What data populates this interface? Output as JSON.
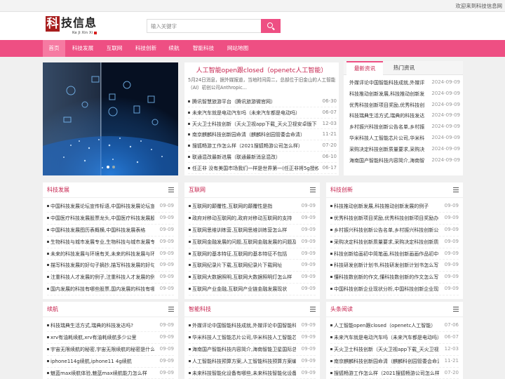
{
  "topbar": {
    "welcome": "欢迎来到科技信息网"
  },
  "logo": {
    "char": "科",
    "title": "技信息",
    "subtitle": "Ke Ji Xin Xi"
  },
  "search": {
    "placeholder": "输入关键字",
    "icon": "search-icon"
  },
  "nav": [
    "首页",
    "科技发展",
    "互联网",
    "科技创新",
    "续航",
    "智能科技",
    "网站地图"
  ],
  "headline": {
    "title": "人工智能open跟closed（openetc人工智能）",
    "summary": "5月24日消息，据外媒报道，当地时间周二，总部位于旧金山的人工智能（AI）初创公司Anthropic..."
  },
  "headline_list": [
    {
      "text": "腾讯智慧旅游平台（腾讯旅游微官网）",
      "date": "06-30"
    },
    {
      "text": "未来汽车就是电动汽车吗（未来汽车都是电动吗）",
      "date": "06-07"
    },
    {
      "text": "天火卫士科技创新（天火卫视app下载_天火卫视安卓版下",
      "date": "12-03"
    },
    {
      "text": "南京麒麟科技创新园命清（麒麟科创园管委会命清）",
      "date": "11-21"
    },
    {
      "text": "搜狐畅游工作怎么样（2021搜狐畅游公司怎么样）",
      "date": "07-20"
    },
    {
      "text": "联通混改最新进展（联通最新消息混改）",
      "date": "06-10"
    },
    {
      "text": "任正非 没有美国市场我们一样是世界第一(任正非将5g授权",
      "date": "06-17"
    }
  ],
  "news_tabs": [
    "最新资讯",
    "热门资讯"
  ],
  "news_list": [
    {
      "text": "外媒评论中国智能科技成就,外媒评",
      "date": "2024-09-09"
    },
    {
      "text": "科技推动创新发展,科技推动创新发",
      "date": "2024-09-09"
    },
    {
      "text": "优秀科技创新项目奖励,优秀科技创",
      "date": "2024-09-09"
    },
    {
      "text": "科技瑞典生活方式,瑞典的科技发达",
      "date": "2024-09-09"
    },
    {
      "text": "乡村振兴科技创新公告名单,乡村振",
      "date": "2024-09-09"
    },
    {
      "text": "华米科技人工智能芯片公司,华米科",
      "date": "2024-09-09"
    },
    {
      "text": "采购决定科技创新质量要求,采购决",
      "date": "2024-09-09"
    },
    {
      "text": "海南国产智能科技内容简介,海南智",
      "date": "2024-09-09"
    }
  ],
  "box_date": "09-09",
  "boxes": [
    {
      "title": "科技发展",
      "items": [
        "中国科技发展论坛宣传标语,中国科技发展论坛宣传",
        "中国医疗科技发展股票龙头,中国医疗科技发展股票",
        "中国科技发展图历表概横,中国科技发展表格",
        "生物科技与城市发展专业,生物科技与城市发展专业",
        "未来的科技发展与环境有关,未来的科技发展与环境",
        "描写科技发展的好句子摘抄,描写科技发展的好句子",
        "注重科技人才发展的例子,注重科技人才发展的例子",
        "国内发展的科技有哪些股票,国内发展的科技有哪些"
      ]
    },
    {
      "title": "互联网",
      "items": [
        "互联网的颠覆性,互联网的颠覆性是指",
        "政府对移动互联网的,政府对移动互联网的支持",
        "互联网思维训练营,互联网思维训练营怎么样",
        "互联网金融发展的问题,互联网金融发展的问题及对",
        "互联网的基本特征,互联网的基本特征不包括",
        "互联网纪录片下载,互联网纪录片下载网址",
        "互联网大数据照明,互联网大数据照明灯怎么样",
        "互联网产业金融,互联网产业链金融发展现状"
      ]
    },
    {
      "title": "科技创新",
      "items": [
        "科技推动创新发展,科技推动创新发展的例子",
        "优秀科技创新项目奖励,优秀科技创新项目奖励办法",
        "乡村振兴科技创新公告名单,乡村振兴科技创新公告",
        "采购决定科技创新质量要求,采购决定科技创新质量",
        "科技创新绘画初中简笔画,科技创新画画作品初中",
        "科技研发创新计划书,科技研发创新计划书怎么写",
        "懂科技数创新的作文,懂科技数创新的作文怎么写",
        "中国科技创新企业现状分析,中国科技创新企业现状"
      ]
    },
    {
      "title": "续航",
      "items": [
        "科技瑞典生活方式,瑞典的科技发达吗?",
        "xrv有油耗续航,xrv有油耗续航多少公里",
        "宇宙无限续航的秘密,宇宙无限续航的秘密是什么",
        "iphone114g续航,iphone11 4g续航",
        "魅蓝max续航体验,魅蓝max续航能力怎么样"
      ]
    },
    {
      "title": "智能科技",
      "items": [
        "外媒评论中国智能科技成就,外媒评论中国智能科技",
        "华米科技人工智能芯片公司,华米科技人工智能芯片",
        "海南国产智能科技内容简介,海南智能卫星国际总部大",
        "人工智能科技预算方案,人工智能科技预算方案编写",
        "未来科技智能化设备有哪些,未来科技智能化设备有"
      ]
    },
    {
      "title": "头条阅读",
      "dates": [
        "07-06",
        "06-07",
        "12-03",
        "11-21",
        "07-20"
      ],
      "items": [
        "人工智能open跟closed（openetc人工智能）",
        "未来汽车就是电动汽车吗（未来汽车都是电动吗）",
        "天火卫士科技创新（天火卫视app下载_天火卫视安",
        "南京麒麟科技创新园命清（麒麟科创园管委会命清",
        "搜狐畅游工作怎么样（2021搜狐畅游公司怎么样）"
      ]
    }
  ]
}
